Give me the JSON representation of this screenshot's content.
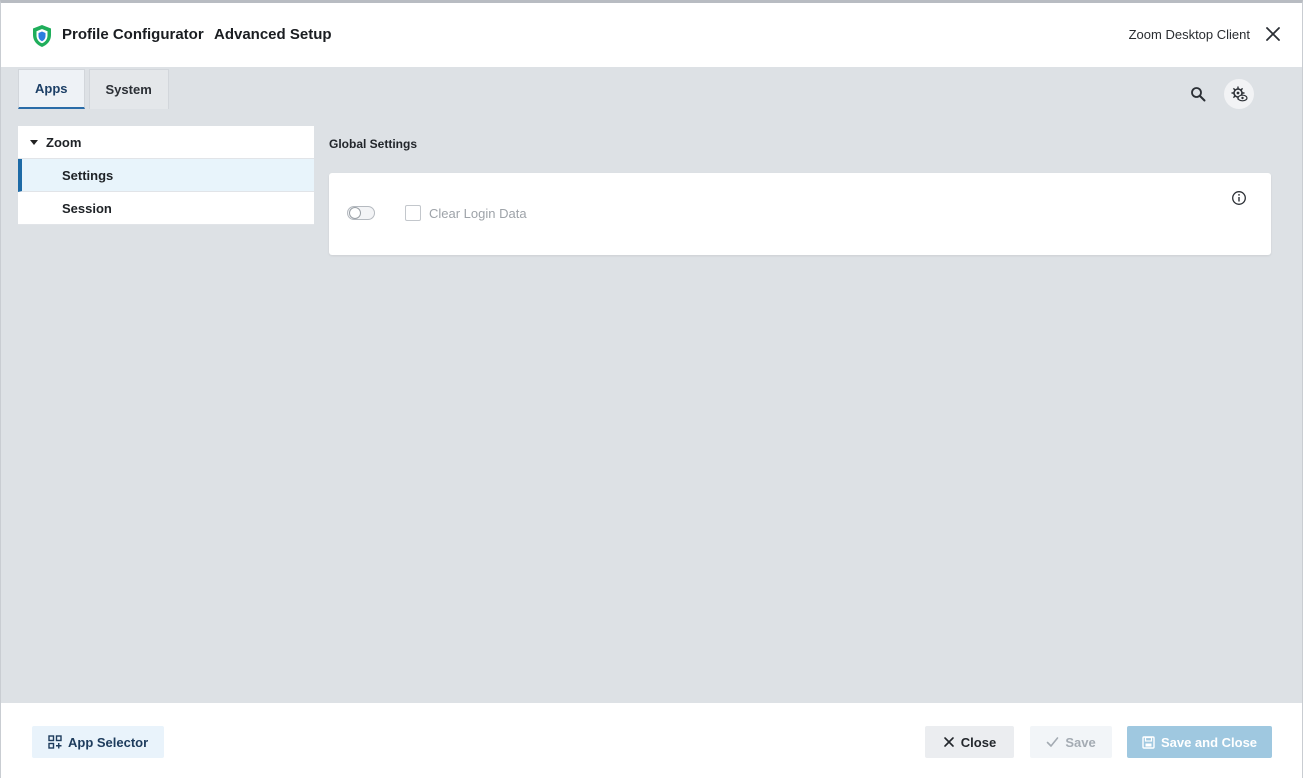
{
  "header": {
    "app_name": "Profile Configurator",
    "setup_title": "Advanced Setup",
    "client_name": "Zoom Desktop Client"
  },
  "tabs": [
    {
      "label": "Apps",
      "active": true
    },
    {
      "label": "System",
      "active": false
    }
  ],
  "tree": {
    "parent": "Zoom",
    "items": [
      {
        "label": "Settings",
        "selected": true
      },
      {
        "label": "Session",
        "selected": false
      }
    ]
  },
  "content": {
    "section_title": "Global Settings",
    "card": {
      "checkbox_label": "Clear Login Data",
      "toggle_on": false,
      "checked": false
    }
  },
  "footer": {
    "app_selector": "App Selector",
    "close": "Close",
    "save": "Save",
    "save_and_close": "Save and Close"
  },
  "colors": {
    "accent": "#1d6aa6",
    "brand_green": "#1fae5b",
    "primary_disabled": "#9fc8e0"
  }
}
